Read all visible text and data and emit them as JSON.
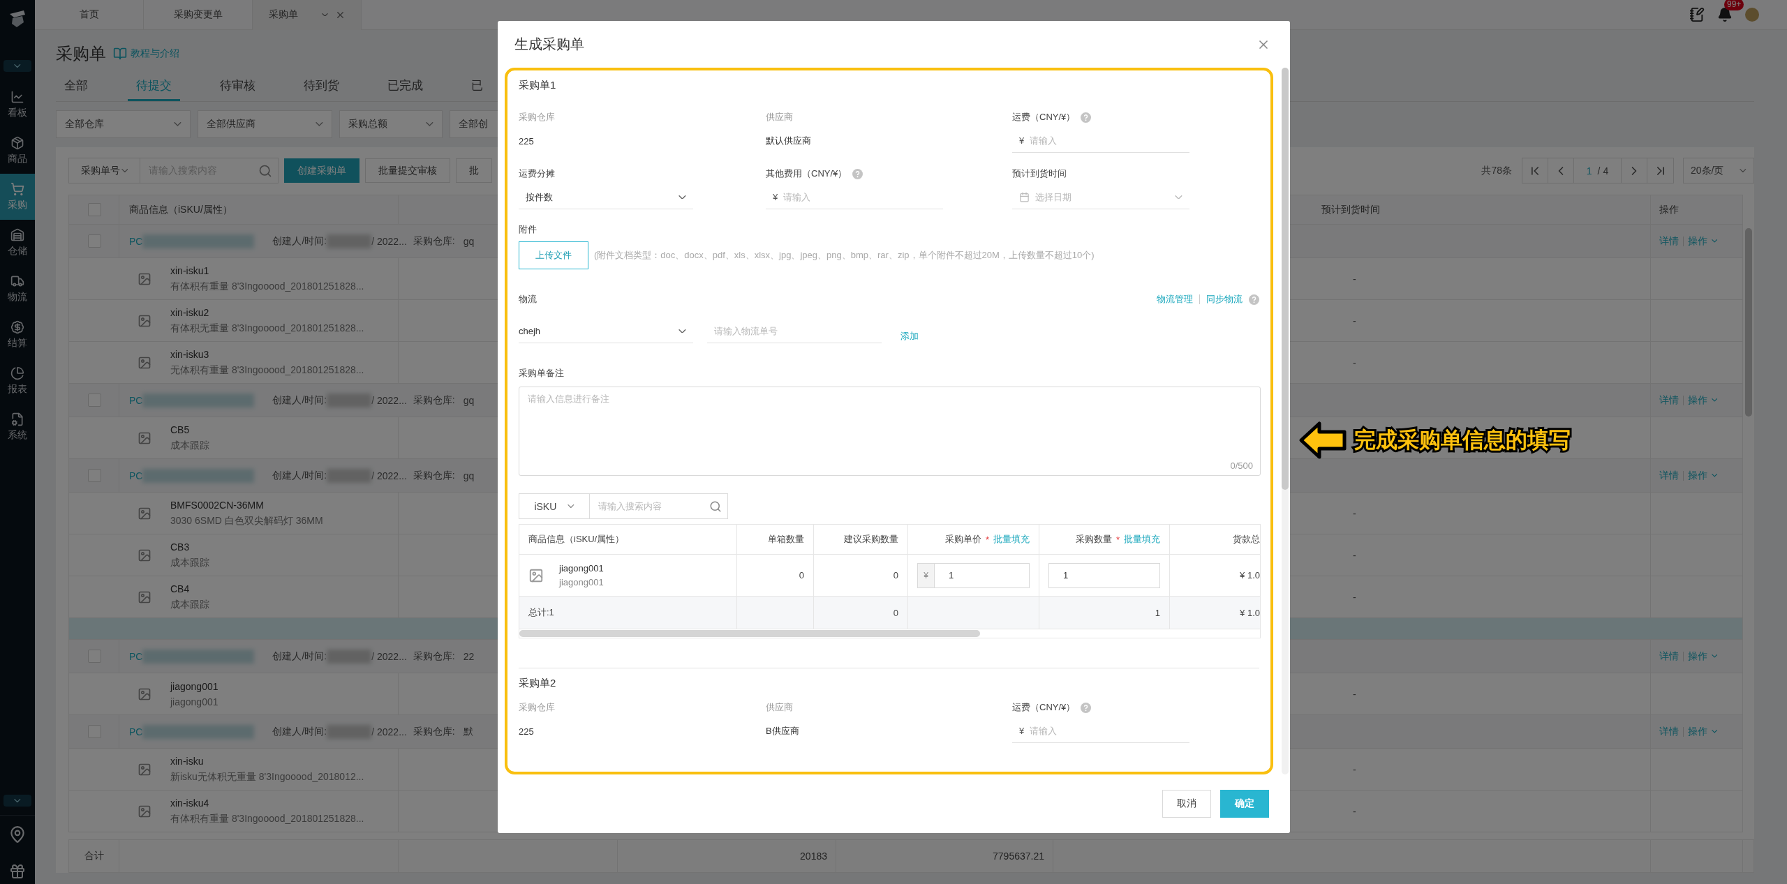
{
  "sidebar": {
    "items": [
      {
        "label": "看板",
        "selected": false
      },
      {
        "label": "商品",
        "selected": false
      },
      {
        "label": "采购",
        "selected": true
      },
      {
        "label": "仓储",
        "selected": false
      },
      {
        "label": "物流",
        "selected": false
      },
      {
        "label": "结算",
        "selected": false
      },
      {
        "label": "报表",
        "selected": false
      },
      {
        "label": "系统",
        "selected": false
      }
    ]
  },
  "top_tabs": [
    {
      "label": "首页",
      "selected": false
    },
    {
      "label": "采购变更单",
      "selected": false
    },
    {
      "label": "采购单",
      "selected": true
    }
  ],
  "notifications_badge": "99+",
  "page": {
    "title": "采购单",
    "help_link": "教程与介绍",
    "status_tabs": [
      {
        "label": "全部",
        "selected": false
      },
      {
        "label": "待提交",
        "selected": true
      },
      {
        "label": "待审核",
        "selected": false
      },
      {
        "label": "待到货",
        "selected": false
      },
      {
        "label": "已完成",
        "selected": false
      },
      {
        "label": "已",
        "selected": false
      }
    ],
    "filters": [
      "全部仓库",
      "全部供应商",
      "采购总额",
      "全部创"
    ],
    "search": {
      "field": "采购单号",
      "placeholder": "请输入搜索内容"
    },
    "buttons": [
      {
        "label": "创建采购单",
        "kind": "primary"
      },
      {
        "label": "批量提交审核",
        "kind": "default"
      },
      {
        "label": "批",
        "kind": "default"
      }
    ],
    "pagination": {
      "total": "共78条",
      "page": "1",
      "pages": "/ 4",
      "page_size": "20条/页"
    }
  },
  "table": {
    "columns": [
      "商品信息（iSKU/属性）",
      "预计到货时间",
      "操作"
    ],
    "select_all_checked": false,
    "rows": [
      {
        "kind": "group",
        "checked": false,
        "id_prefix": "PC",
        "creator_label": "创建人/时间:",
        "date": "/ 2022...",
        "warehouse_label": "采购仓库:",
        "warehouse": "gq",
        "actions": [
          "详情",
          "操作"
        ]
      },
      {
        "kind": "item",
        "name": "xin-isku1",
        "attrs": "有体积有重量 8'3Ingooood_201801251828...",
        "due": "-"
      },
      {
        "kind": "item",
        "name": "xin-isku2",
        "attrs": "有体积无重量 8'3Ingooood_201801251828...",
        "due": "-"
      },
      {
        "kind": "item",
        "name": "xin-isku3",
        "attrs": "无体积有重量 8'3Ingooood_201801251828...",
        "due": "-"
      },
      {
        "kind": "group",
        "checked": false,
        "id_prefix": "PC",
        "creator_label": "创建人/时间:",
        "date": "/ 2022...",
        "warehouse_label": "采购仓库:",
        "warehouse": "gq",
        "actions": [
          "详情",
          "操作"
        ]
      },
      {
        "kind": "item",
        "name": "CB5",
        "attrs": "成本跟踪"
      },
      {
        "kind": "group",
        "checked": false,
        "id_prefix": "PC",
        "creator_label": "创建人/时间:",
        "date": "/ 2022...",
        "warehouse_label": "采购仓库:",
        "warehouse": "gq",
        "actions": [
          "详情",
          "操作"
        ]
      },
      {
        "kind": "item",
        "name": "BMFS0002CN-36MM",
        "attrs": "3030 6SMD 白色双尖解码灯 36MM",
        "due": "-"
      },
      {
        "kind": "item",
        "name": "CB3",
        "attrs": "成本跟踪",
        "due": "-"
      },
      {
        "kind": "item",
        "name": "CB4",
        "attrs": "成本跟踪",
        "due": "-"
      },
      {
        "kind": "highlight"
      },
      {
        "kind": "group",
        "checked": false,
        "id_prefix": "PC",
        "creator_label": "创建人/时间:",
        "date": "/ 2022...",
        "warehouse_label": "采购仓库:",
        "warehouse": "22",
        "actions": [
          "详情",
          "操作"
        ]
      },
      {
        "kind": "item",
        "name": "jiagong001",
        "attrs": "jiagong001",
        "due": "-"
      },
      {
        "kind": "group",
        "checked": false,
        "id_prefix": "PC",
        "creator_label": "创建人/时间:",
        "date": "/ 2022...",
        "warehouse_label": "采购仓库:",
        "warehouse": "默",
        "actions": [
          "详情",
          "操作"
        ]
      },
      {
        "kind": "item",
        "name": "xin-isku",
        "attrs": "新isku无体积无重量 8'3Ingooood_2018012...",
        "due": "-"
      },
      {
        "kind": "item",
        "name": "xin-isku4",
        "attrs": "有体积有重量 8'3Ingooood_201801251828...",
        "due": "-"
      }
    ],
    "totals": {
      "label": "合计",
      "values": [
        "20183",
        "7795637.21"
      ]
    }
  },
  "dialog": {
    "title": "生成采购单",
    "orders": [
      {
        "title": "采购单1",
        "fields": [
          {
            "label": "采购仓库",
            "kind": "text",
            "value": "225"
          },
          {
            "label": "供应商",
            "kind": "text",
            "value": "默认供应商"
          },
          {
            "label": "运费（CNY/¥）",
            "kind": "money",
            "help": true,
            "currency": "¥",
            "placeholder": "请输入"
          },
          {
            "label": "运费分摊",
            "kind": "select",
            "value": "按件数"
          },
          {
            "label": "其他费用（CNY/¥）",
            "kind": "money",
            "help": true,
            "currency": "¥",
            "placeholder": "请输入"
          },
          {
            "label": "预计到货时间",
            "kind": "date",
            "placeholder": "选择日期"
          }
        ],
        "attachment": {
          "label": "附件",
          "button": "上传文件",
          "hint": "(附件文档类型：doc、docx、pdf、xls、xlsx、jpg、jpeg、png、bmp、rar、zip，单个附件不超过20M，上传数量不超过10个)"
        },
        "logistics": {
          "label": "物流",
          "links": [
            "物流管理",
            "同步物流"
          ],
          "carrier": "chejh",
          "tracking_placeholder": "请输入物流单号",
          "add": "添加"
        },
        "remarks": {
          "label": "采购单备注",
          "placeholder": "请输入信息进行备注",
          "counter": "0/500"
        },
        "sku_search": {
          "field": "iSKU",
          "placeholder": "请输入搜索内容"
        },
        "items": {
          "columns": [
            {
              "label": "商品信息（iSKU/属性）"
            },
            {
              "label": "单箱数量"
            },
            {
              "label": "建议采购数量"
            },
            {
              "label": "采购单价",
              "mark": "*",
              "action": "批量填充"
            },
            {
              "label": "采购数量",
              "mark": "*",
              "action": "批量填充"
            },
            {
              "label": "货款总"
            }
          ],
          "rows": [
            {
              "sku": "jiagong001",
              "attr": "jiagong001",
              "per_box": "0",
              "suggested": "0",
              "currency": "¥",
              "price": "1",
              "qty": "1",
              "total": "¥ 1.0"
            }
          ],
          "summary": {
            "label": "总计:1",
            "suggested": "0",
            "qty": "1",
            "total": "¥ 1.0"
          }
        }
      },
      {
        "title": "采购单2",
        "fields": [
          {
            "label": "采购仓库",
            "kind": "text",
            "value": "225"
          },
          {
            "label": "供应商",
            "kind": "text",
            "value": "B供应商"
          },
          {
            "label": "运费（CNY/¥）",
            "kind": "money",
            "help": true,
            "currency": "¥",
            "placeholder": "请输入"
          }
        ]
      }
    ],
    "buttons": [
      {
        "label": "取消",
        "kind": "default"
      },
      {
        "label": "确定",
        "kind": "primary"
      }
    ]
  },
  "callout": {
    "text": "完成采购单信息的填写"
  }
}
